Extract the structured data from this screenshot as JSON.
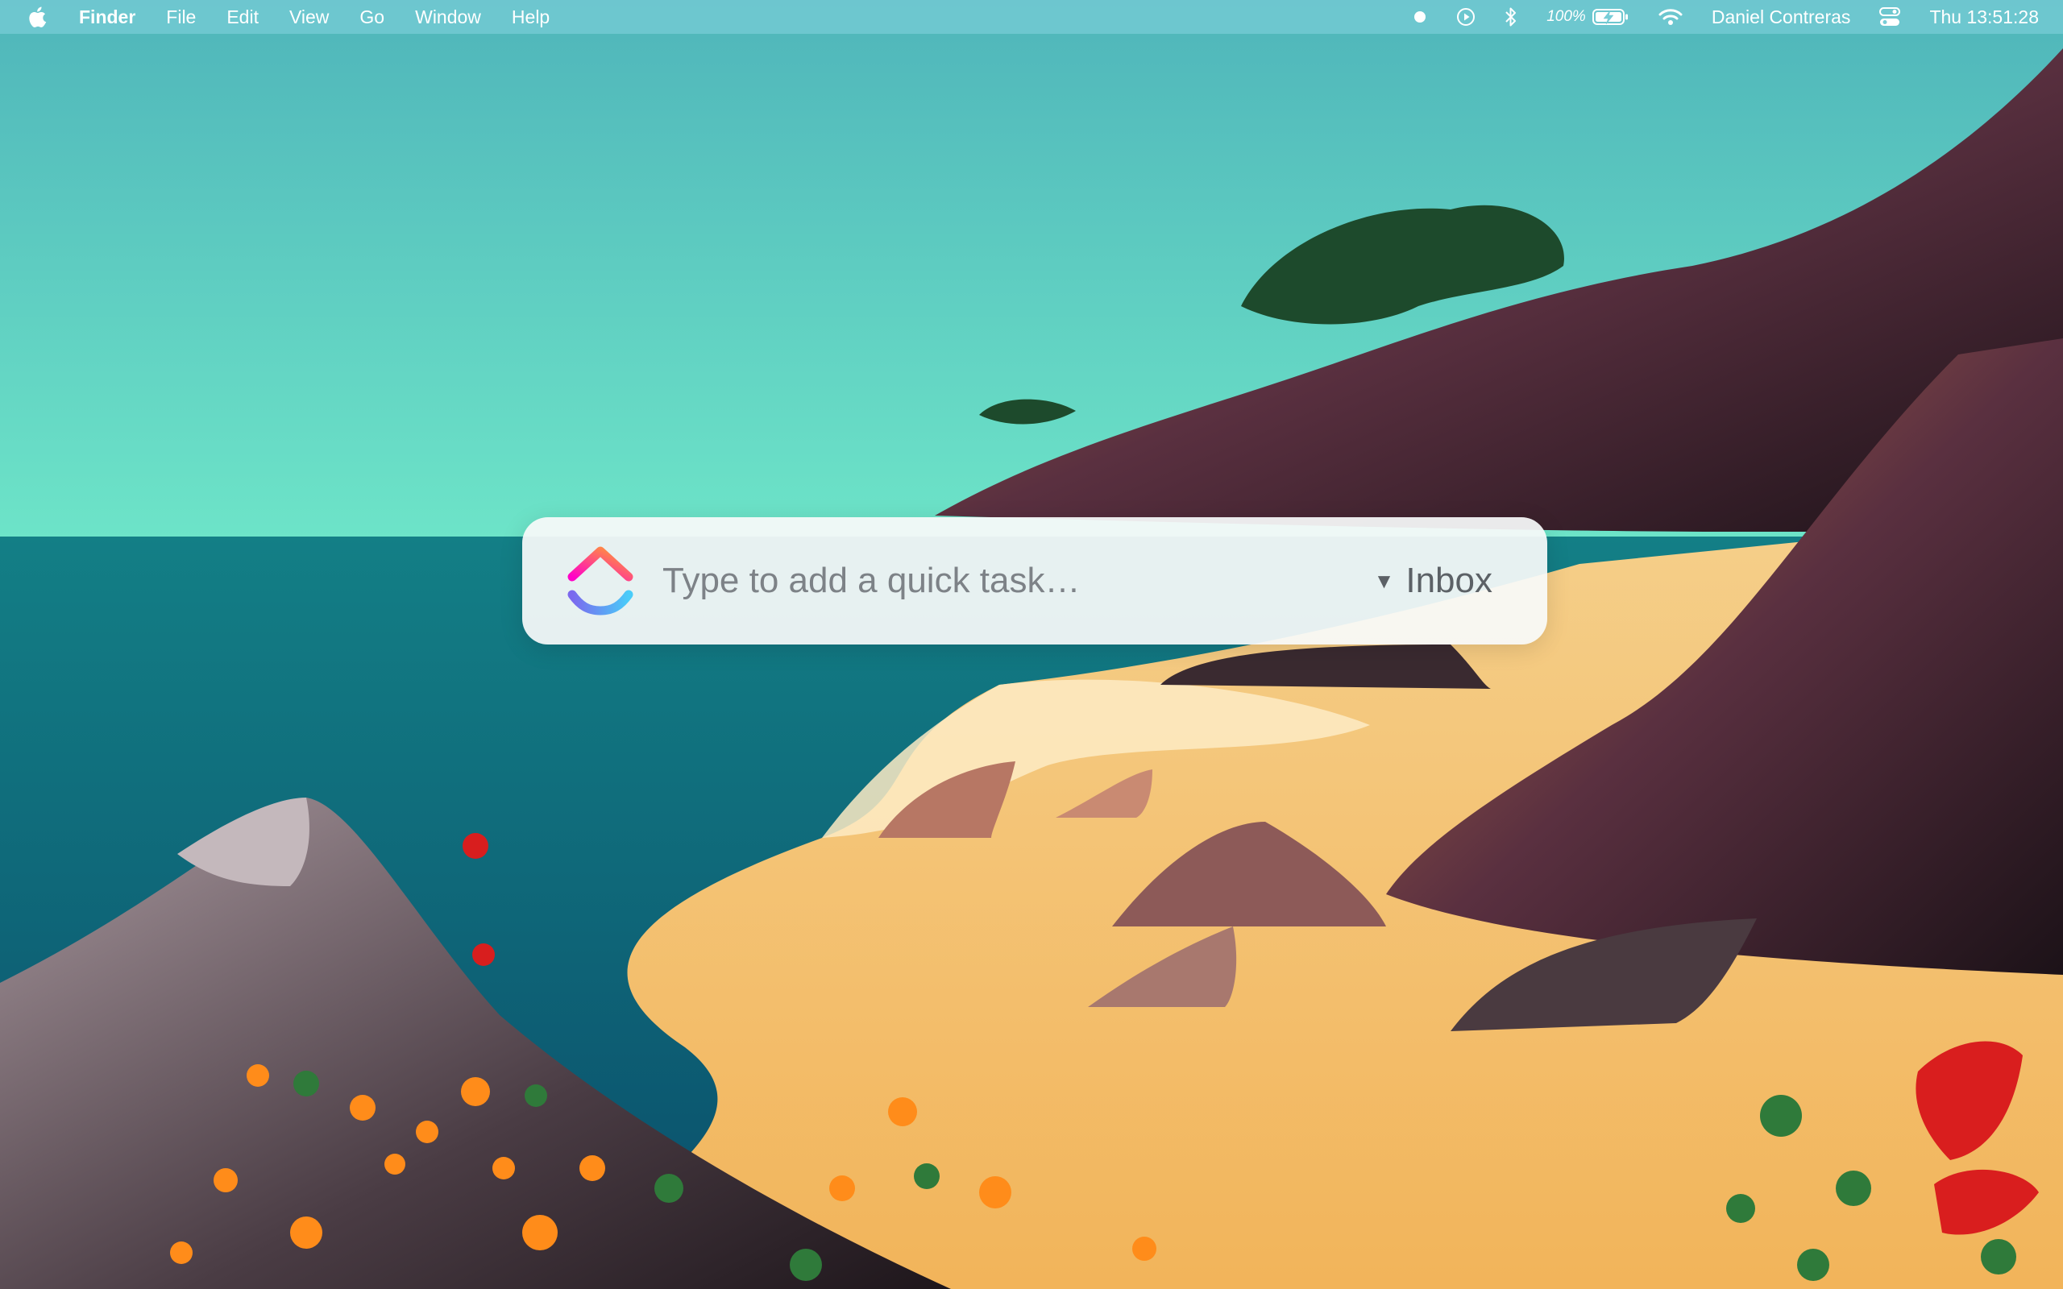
{
  "menubar": {
    "app_name": "Finder",
    "menus": [
      "File",
      "Edit",
      "View",
      "Go",
      "Window",
      "Help"
    ],
    "status": {
      "battery_percent": "100%",
      "user_name": "Daniel Contreras",
      "clock": "Thu 13:51:28"
    }
  },
  "quick_task": {
    "placeholder": "Type to add a quick task…",
    "destination": "Inbox"
  },
  "colors": {
    "menubar_bg": "#78cdd7",
    "logo_pink": "#ff02c8",
    "logo_orange": "#ffa12f",
    "logo_purple": "#7b68ee",
    "logo_blue": "#49ccf9"
  }
}
